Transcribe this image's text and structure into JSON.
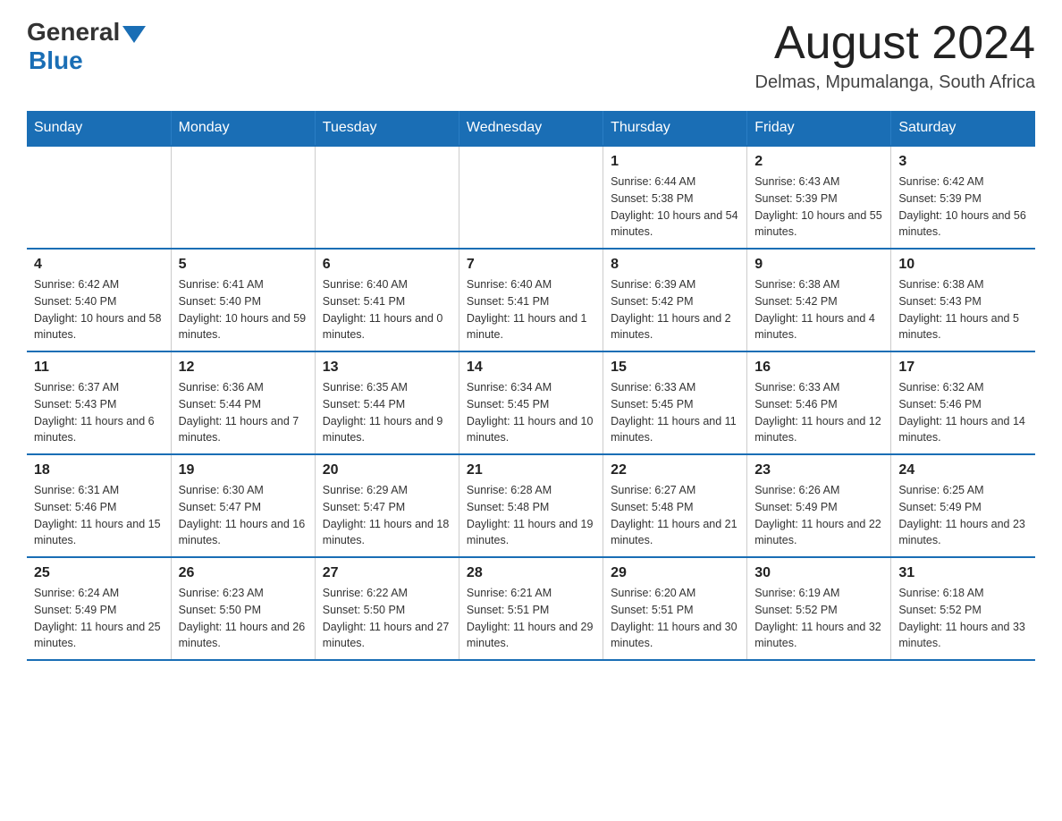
{
  "header": {
    "logo_general": "General",
    "logo_blue": "Blue",
    "month_title": "August 2024",
    "location": "Delmas, Mpumalanga, South Africa"
  },
  "days_of_week": [
    "Sunday",
    "Monday",
    "Tuesday",
    "Wednesday",
    "Thursday",
    "Friday",
    "Saturday"
  ],
  "weeks": [
    [
      {
        "day": "",
        "info": ""
      },
      {
        "day": "",
        "info": ""
      },
      {
        "day": "",
        "info": ""
      },
      {
        "day": "",
        "info": ""
      },
      {
        "day": "1",
        "info": "Sunrise: 6:44 AM\nSunset: 5:38 PM\nDaylight: 10 hours and 54 minutes."
      },
      {
        "day": "2",
        "info": "Sunrise: 6:43 AM\nSunset: 5:39 PM\nDaylight: 10 hours and 55 minutes."
      },
      {
        "day": "3",
        "info": "Sunrise: 6:42 AM\nSunset: 5:39 PM\nDaylight: 10 hours and 56 minutes."
      }
    ],
    [
      {
        "day": "4",
        "info": "Sunrise: 6:42 AM\nSunset: 5:40 PM\nDaylight: 10 hours and 58 minutes."
      },
      {
        "day": "5",
        "info": "Sunrise: 6:41 AM\nSunset: 5:40 PM\nDaylight: 10 hours and 59 minutes."
      },
      {
        "day": "6",
        "info": "Sunrise: 6:40 AM\nSunset: 5:41 PM\nDaylight: 11 hours and 0 minutes."
      },
      {
        "day": "7",
        "info": "Sunrise: 6:40 AM\nSunset: 5:41 PM\nDaylight: 11 hours and 1 minute."
      },
      {
        "day": "8",
        "info": "Sunrise: 6:39 AM\nSunset: 5:42 PM\nDaylight: 11 hours and 2 minutes."
      },
      {
        "day": "9",
        "info": "Sunrise: 6:38 AM\nSunset: 5:42 PM\nDaylight: 11 hours and 4 minutes."
      },
      {
        "day": "10",
        "info": "Sunrise: 6:38 AM\nSunset: 5:43 PM\nDaylight: 11 hours and 5 minutes."
      }
    ],
    [
      {
        "day": "11",
        "info": "Sunrise: 6:37 AM\nSunset: 5:43 PM\nDaylight: 11 hours and 6 minutes."
      },
      {
        "day": "12",
        "info": "Sunrise: 6:36 AM\nSunset: 5:44 PM\nDaylight: 11 hours and 7 minutes."
      },
      {
        "day": "13",
        "info": "Sunrise: 6:35 AM\nSunset: 5:44 PM\nDaylight: 11 hours and 9 minutes."
      },
      {
        "day": "14",
        "info": "Sunrise: 6:34 AM\nSunset: 5:45 PM\nDaylight: 11 hours and 10 minutes."
      },
      {
        "day": "15",
        "info": "Sunrise: 6:33 AM\nSunset: 5:45 PM\nDaylight: 11 hours and 11 minutes."
      },
      {
        "day": "16",
        "info": "Sunrise: 6:33 AM\nSunset: 5:46 PM\nDaylight: 11 hours and 12 minutes."
      },
      {
        "day": "17",
        "info": "Sunrise: 6:32 AM\nSunset: 5:46 PM\nDaylight: 11 hours and 14 minutes."
      }
    ],
    [
      {
        "day": "18",
        "info": "Sunrise: 6:31 AM\nSunset: 5:46 PM\nDaylight: 11 hours and 15 minutes."
      },
      {
        "day": "19",
        "info": "Sunrise: 6:30 AM\nSunset: 5:47 PM\nDaylight: 11 hours and 16 minutes."
      },
      {
        "day": "20",
        "info": "Sunrise: 6:29 AM\nSunset: 5:47 PM\nDaylight: 11 hours and 18 minutes."
      },
      {
        "day": "21",
        "info": "Sunrise: 6:28 AM\nSunset: 5:48 PM\nDaylight: 11 hours and 19 minutes."
      },
      {
        "day": "22",
        "info": "Sunrise: 6:27 AM\nSunset: 5:48 PM\nDaylight: 11 hours and 21 minutes."
      },
      {
        "day": "23",
        "info": "Sunrise: 6:26 AM\nSunset: 5:49 PM\nDaylight: 11 hours and 22 minutes."
      },
      {
        "day": "24",
        "info": "Sunrise: 6:25 AM\nSunset: 5:49 PM\nDaylight: 11 hours and 23 minutes."
      }
    ],
    [
      {
        "day": "25",
        "info": "Sunrise: 6:24 AM\nSunset: 5:49 PM\nDaylight: 11 hours and 25 minutes."
      },
      {
        "day": "26",
        "info": "Sunrise: 6:23 AM\nSunset: 5:50 PM\nDaylight: 11 hours and 26 minutes."
      },
      {
        "day": "27",
        "info": "Sunrise: 6:22 AM\nSunset: 5:50 PM\nDaylight: 11 hours and 27 minutes."
      },
      {
        "day": "28",
        "info": "Sunrise: 6:21 AM\nSunset: 5:51 PM\nDaylight: 11 hours and 29 minutes."
      },
      {
        "day": "29",
        "info": "Sunrise: 6:20 AM\nSunset: 5:51 PM\nDaylight: 11 hours and 30 minutes."
      },
      {
        "day": "30",
        "info": "Sunrise: 6:19 AM\nSunset: 5:52 PM\nDaylight: 11 hours and 32 minutes."
      },
      {
        "day": "31",
        "info": "Sunrise: 6:18 AM\nSunset: 5:52 PM\nDaylight: 11 hours and 33 minutes."
      }
    ]
  ]
}
